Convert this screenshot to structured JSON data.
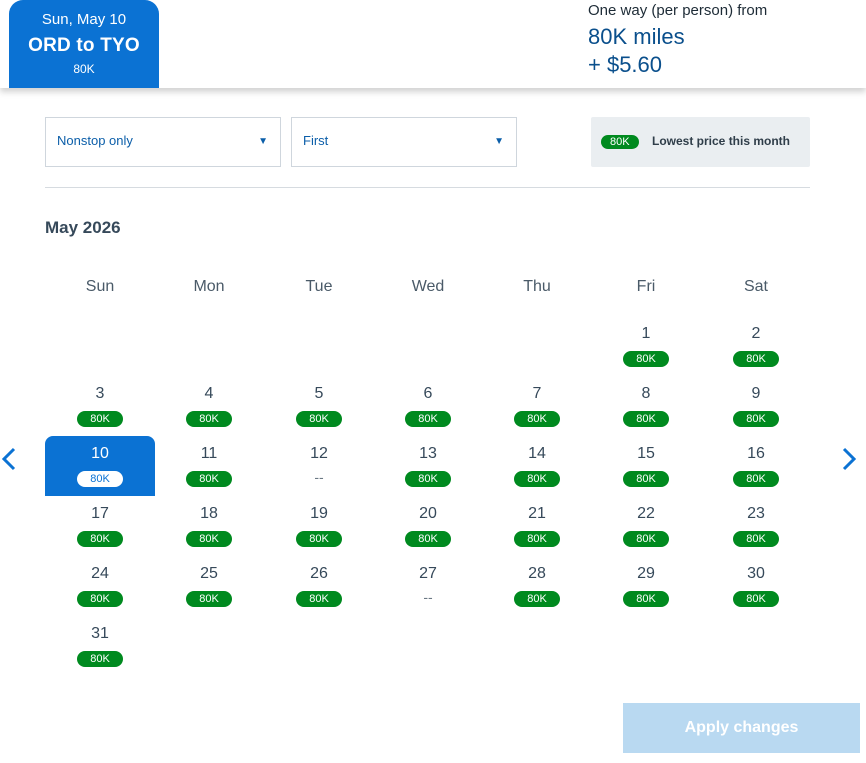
{
  "header": {
    "tab_date": "Sun, May 10",
    "tab_route": "ORD to TYO",
    "tab_price": "80K",
    "fare_label": "One way (per person) from",
    "fare_miles": "80K miles",
    "fare_tax": "+ $5.60"
  },
  "filters": {
    "stops": "Nonstop only",
    "cabin": "First",
    "legend_pill": "80K",
    "legend_text": "Lowest price this month"
  },
  "calendar": {
    "month_label": "May 2026",
    "weekdays": [
      "Sun",
      "Mon",
      "Tue",
      "Wed",
      "Thu",
      "Fri",
      "Sat"
    ],
    "days": [
      {
        "day": "1",
        "price": "80K"
      },
      {
        "day": "2",
        "price": "80K"
      },
      {
        "day": "3",
        "price": "80K"
      },
      {
        "day": "4",
        "price": "80K"
      },
      {
        "day": "5",
        "price": "80K"
      },
      {
        "day": "6",
        "price": "80K"
      },
      {
        "day": "7",
        "price": "80K"
      },
      {
        "day": "8",
        "price": "80K"
      },
      {
        "day": "9",
        "price": "80K"
      },
      {
        "day": "10",
        "price": "80K",
        "selected": true
      },
      {
        "day": "11",
        "price": "80K"
      },
      {
        "day": "12",
        "price": "--"
      },
      {
        "day": "13",
        "price": "80K"
      },
      {
        "day": "14",
        "price": "80K"
      },
      {
        "day": "15",
        "price": "80K"
      },
      {
        "day": "16",
        "price": "80K"
      },
      {
        "day": "17",
        "price": "80K"
      },
      {
        "day": "18",
        "price": "80K"
      },
      {
        "day": "19",
        "price": "80K"
      },
      {
        "day": "20",
        "price": "80K"
      },
      {
        "day": "21",
        "price": "80K"
      },
      {
        "day": "22",
        "price": "80K"
      },
      {
        "day": "23",
        "price": "80K"
      },
      {
        "day": "24",
        "price": "80K"
      },
      {
        "day": "25",
        "price": "80K"
      },
      {
        "day": "26",
        "price": "80K"
      },
      {
        "day": "27",
        "price": "--"
      },
      {
        "day": "28",
        "price": "80K"
      },
      {
        "day": "29",
        "price": "80K"
      },
      {
        "day": "30",
        "price": "80K"
      },
      {
        "day": "31",
        "price": "80K"
      }
    ]
  },
  "icons": {
    "prev": "chevron-left-icon",
    "next": "chevron-right-icon",
    "dropdown": "caret-down-icon"
  },
  "colors": {
    "brand_blue": "#0b72d3",
    "price_green": "#008a1f",
    "apply_disabled": "#b9d9f1"
  },
  "actions": {
    "apply_label": "Apply changes"
  }
}
